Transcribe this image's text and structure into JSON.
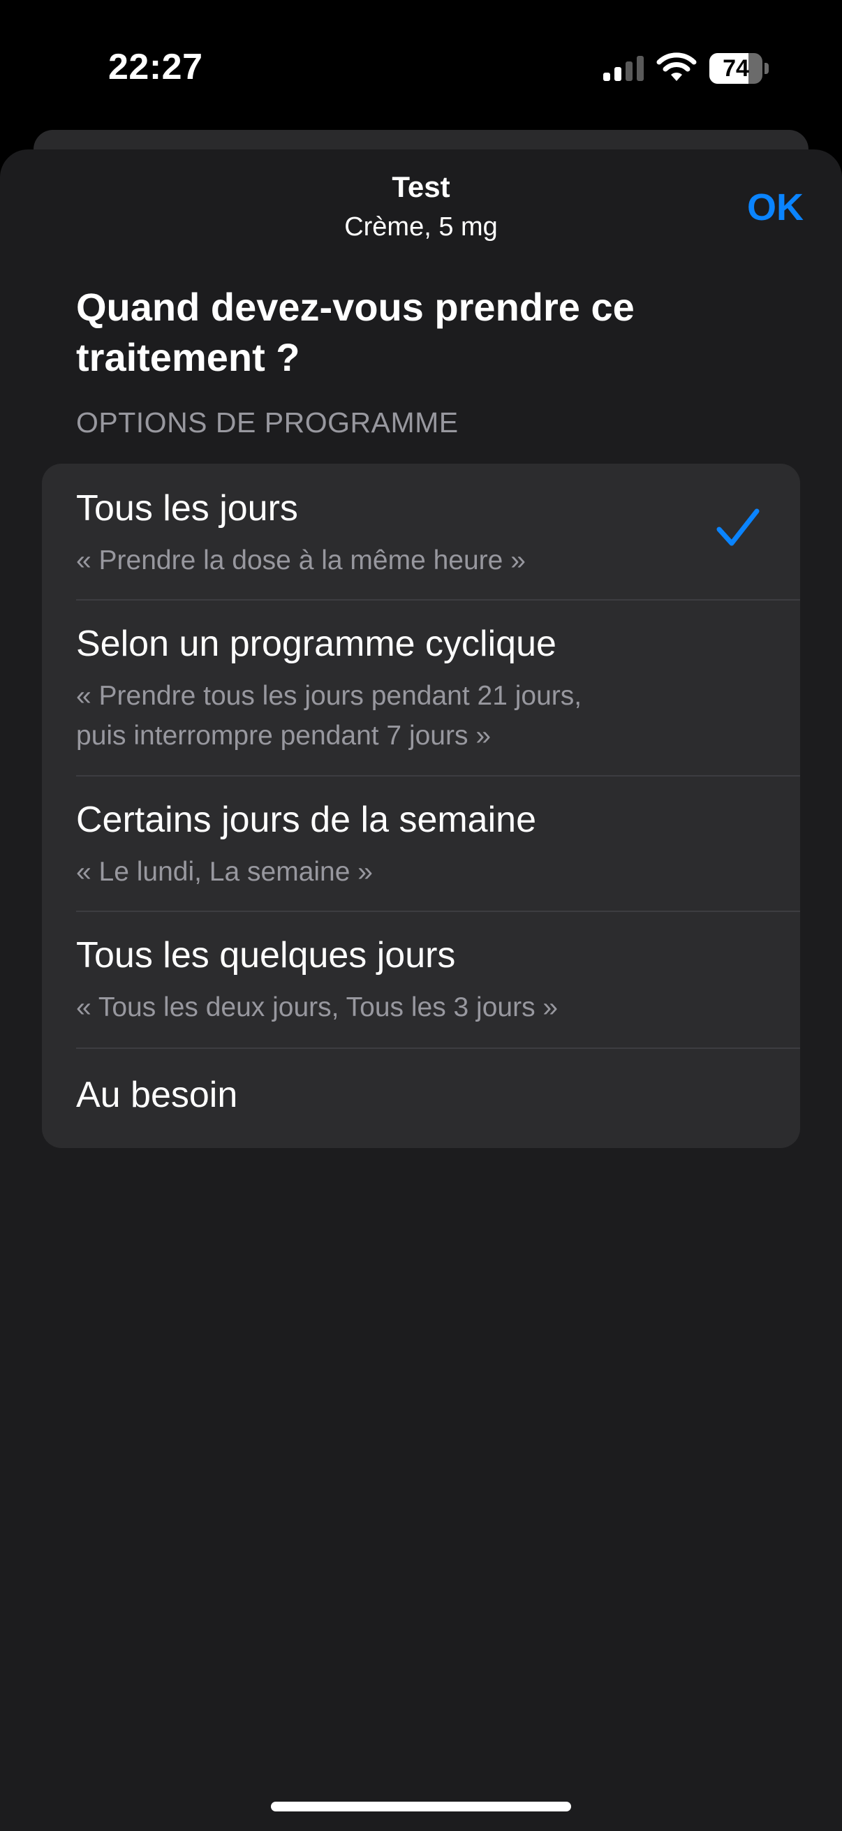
{
  "status_bar": {
    "time": "22:27",
    "battery_percent": "74",
    "battery_level": 0.74,
    "icons": [
      "cellular-signal-icon",
      "wifi-icon",
      "battery-icon"
    ]
  },
  "header": {
    "title": "Test",
    "subtitle": "Crème, 5 mg",
    "ok_label": "OK"
  },
  "question": "Quand devez-vous prendre ce traitement ?",
  "section_header": "OPTIONS DE PROGRAMME",
  "options": [
    {
      "title": "Tous les jours",
      "description": "« Prendre la dose à la même heure »",
      "selected": true
    },
    {
      "title": "Selon un programme cyclique",
      "description_lines": [
        "« Prendre tous les jours pendant 21 jours,",
        "puis interrompre pendant 7 jours »"
      ],
      "selected": false
    },
    {
      "title": "Certains jours de la semaine",
      "description": "« Le lundi, La semaine »",
      "selected": false
    },
    {
      "title": "Tous les quelques jours",
      "description": "« Tous les deux jours, Tous les 3 jours »",
      "selected": false
    },
    {
      "title": "Au besoin",
      "selected": false
    }
  ],
  "colors": {
    "accent": "#0a84ff",
    "background": "#1c1c1e",
    "card": "#2c2c2e",
    "secondary_text": "#98989f"
  }
}
